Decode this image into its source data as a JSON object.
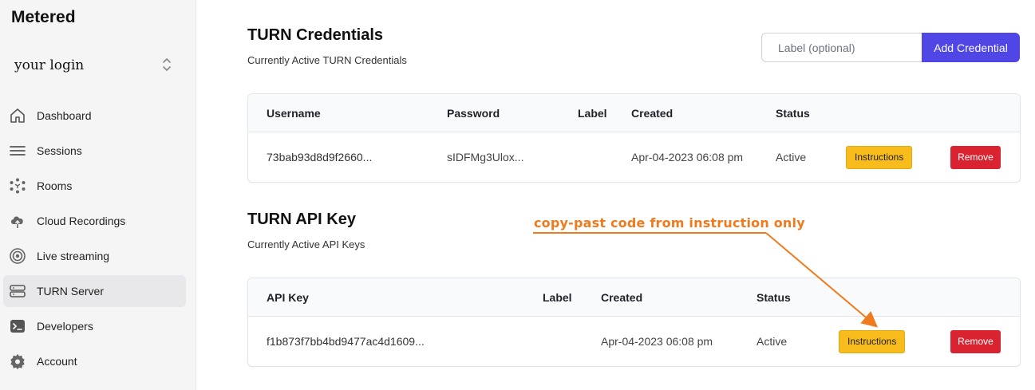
{
  "sidebar": {
    "brand": "Metered",
    "login": "your login",
    "items": [
      {
        "label": "Dashboard",
        "icon": "home-icon",
        "active": false
      },
      {
        "label": "Sessions",
        "icon": "list-icon",
        "active": false
      },
      {
        "label": "Rooms",
        "icon": "rooms-icon",
        "active": false
      },
      {
        "label": "Cloud Recordings",
        "icon": "cloud-upload-icon",
        "active": false
      },
      {
        "label": "Live streaming",
        "icon": "broadcast-icon",
        "active": false
      },
      {
        "label": "TURN Server",
        "icon": "server-icon",
        "active": true
      },
      {
        "label": "Developers",
        "icon": "terminal-icon",
        "active": false
      },
      {
        "label": "Account",
        "icon": "gear-icon",
        "active": false
      }
    ]
  },
  "credentials": {
    "title": "TURN Credentials",
    "subtitle": "Currently Active TURN Credentials",
    "label_placeholder": "Label (optional)",
    "add_button": "Add Credential",
    "columns": {
      "username": "Username",
      "password": "Password",
      "label": "Label",
      "created": "Created",
      "status": "Status"
    },
    "rows": [
      {
        "username": "73bab93d8d9f2660...",
        "password": "sIDFMg3Ulox...",
        "label": "",
        "created": "Apr-04-2023 06:08 pm",
        "status": "Active",
        "instructions": "Instructions",
        "remove": "Remove"
      }
    ]
  },
  "api_keys": {
    "title": "TURN API Key",
    "subtitle": "Currently Active API Keys",
    "columns": {
      "api_key": "API Key",
      "label": "Label",
      "created": "Created",
      "status": "Status"
    },
    "rows": [
      {
        "api_key": "f1b873f7bb4bd9477ac4d1609...",
        "label": "",
        "created": "Apr-04-2023 06:08 pm",
        "status": "Active",
        "instructions": "Instructions",
        "remove": "Remove"
      }
    ]
  },
  "annotation": {
    "text": "copy-past code from instruction only",
    "color": "#f07b1e"
  },
  "colors": {
    "primary": "#5046e5",
    "instructions": "#f8bd1c",
    "remove": "#d92331"
  }
}
